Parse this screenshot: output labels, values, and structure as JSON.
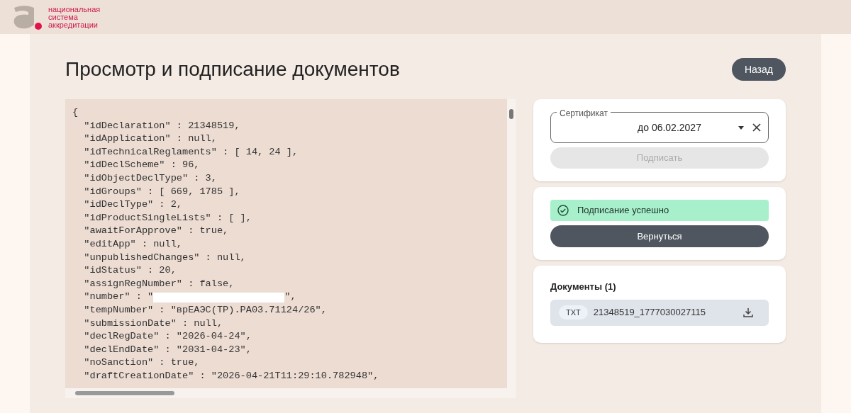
{
  "logo": {
    "lines": [
      "национальная",
      "система",
      "аккредитации"
    ]
  },
  "page": {
    "title": "Просмотр и подписание документов",
    "back_button": "Назад"
  },
  "code_view": {
    "lines": [
      {
        "kind": "text",
        "text": "{"
      },
      {
        "kind": "text",
        "text": "  \"idDeclaration\" : 21348519,"
      },
      {
        "kind": "text",
        "text": "  \"idApplication\" : null,"
      },
      {
        "kind": "text",
        "text": "  \"idTechnicalReglaments\" : [ 14, 24 ],"
      },
      {
        "kind": "text",
        "text": "  \"idDeclScheme\" : 96,"
      },
      {
        "kind": "text",
        "text": "  \"idObjectDeclType\" : 3,"
      },
      {
        "kind": "text",
        "text": "  \"idGroups\" : [ 669, 1785 ],"
      },
      {
        "kind": "text",
        "text": "  \"idDeclType\" : 2,"
      },
      {
        "kind": "text",
        "text": "  \"idProductSingleLists\" : [ ],"
      },
      {
        "kind": "text",
        "text": "  \"awaitForApprove\" : true,"
      },
      {
        "kind": "text",
        "text": "  \"editApp\" : null,"
      },
      {
        "kind": "text",
        "text": "  \"unpublishedChanges\" : null,"
      },
      {
        "kind": "text",
        "text": "  \"idStatus\" : 20,"
      },
      {
        "kind": "text",
        "text": "  \"assignRegNumber\" : false,"
      },
      {
        "kind": "redacted",
        "before": "  \"number\" : \"",
        "after": "\","
      },
      {
        "kind": "text",
        "text": "  \"tempNumber\" : \"врЕАЭС(ТР).РА03.71124/26\","
      },
      {
        "kind": "text",
        "text": "  \"submissionDate\" : null,"
      },
      {
        "kind": "text",
        "text": "  \"declRegDate\" : \"2026-04-24\","
      },
      {
        "kind": "text",
        "text": "  \"declEndDate\" : \"2031-04-23\","
      },
      {
        "kind": "text",
        "text": "  \"noSanction\" : true,"
      },
      {
        "kind": "text",
        "text": "  \"draftCreationDate\" : \"2026-04-21T11:29:10.782948\","
      }
    ]
  },
  "sign_card": {
    "certificate_label": "Сертификат",
    "certificate_value": "до 06.02.2027",
    "sign_button": {
      "label": "Подписать",
      "disabled": true
    }
  },
  "status_card": {
    "message": "Подписание успешно",
    "return_button": "Вернуться"
  },
  "documents": {
    "title": "Документы (1)",
    "items": [
      {
        "type": "TXT",
        "name": "21348519_1777030027115"
      }
    ]
  }
}
